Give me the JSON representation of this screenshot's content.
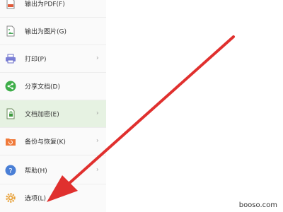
{
  "menu": {
    "items": [
      {
        "label": "输出为PDF(F)",
        "icon": "pdf-icon"
      },
      {
        "label": "输出为图片(G)",
        "icon": "image-export-icon"
      },
      {
        "label": "打印(P)",
        "icon": "printer-icon",
        "has_submenu": true
      },
      {
        "label": "分享文档(D)",
        "icon": "share-icon"
      },
      {
        "label": "文档加密(E)",
        "icon": "lock-document-icon",
        "has_submenu": true,
        "active": true
      },
      {
        "label": "备份与恢复(K)",
        "icon": "backup-icon",
        "has_submenu": true
      },
      {
        "label": "帮助(H)",
        "icon": "help-icon",
        "has_submenu": true
      },
      {
        "label": "选项(L)",
        "icon": "gear-icon"
      }
    ],
    "submenu_glyph": "›"
  },
  "annotation": {
    "color": "#e0302e"
  },
  "watermark": "booso.com"
}
